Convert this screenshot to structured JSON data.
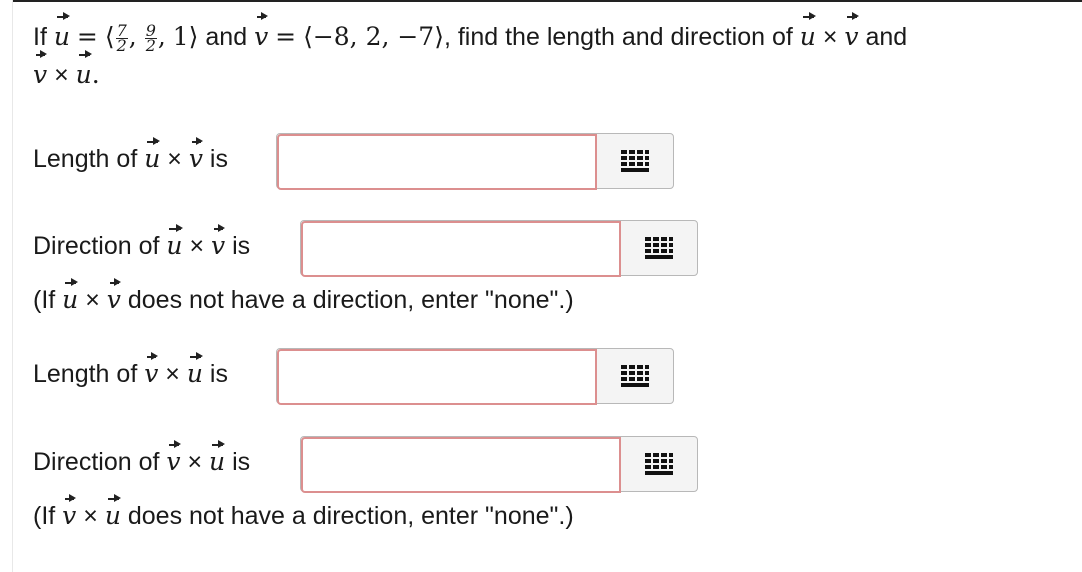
{
  "question": {
    "if": "If",
    "u": "u",
    "v": "v",
    "eq": "=",
    "u_open": "⟨",
    "u_frac1_num": "7",
    "u_frac1_den": "2",
    "comma": ",",
    "u_frac2_num": "9",
    "u_frac2_den": "2",
    "u_rest": "1⟩",
    "and": "and",
    "v_value": "⟨−8, 2, −7⟩",
    "find_text": ", find the length and direction of",
    "times": "×",
    "and2": "and",
    "period": "."
  },
  "fields": [
    {
      "label_prefix": "Length of",
      "first": "u",
      "second": "v",
      "label_suffix": "is",
      "value": "",
      "placeholder": ""
    },
    {
      "label_prefix": "Direction of",
      "first": "u",
      "second": "v",
      "label_suffix": "is",
      "value": "",
      "placeholder": "",
      "hint_prefix": "(If",
      "hint_suffix": "does not have a direction, enter \"none\".)"
    },
    {
      "label_prefix": "Length of",
      "first": "v",
      "second": "u",
      "label_suffix": "is",
      "value": "",
      "placeholder": ""
    },
    {
      "label_prefix": "Direction of",
      "first": "v",
      "second": "u",
      "label_suffix": "is",
      "value": "",
      "placeholder": "",
      "hint_prefix": "(If",
      "hint_suffix": "does not have a direction, enter \"none\".)"
    }
  ],
  "icons": {
    "keypad": "keypad-icon"
  },
  "colors": {
    "input_border": "#dc8f8f",
    "keypad_bg": "#f4f4f4",
    "icon": "#111111"
  }
}
